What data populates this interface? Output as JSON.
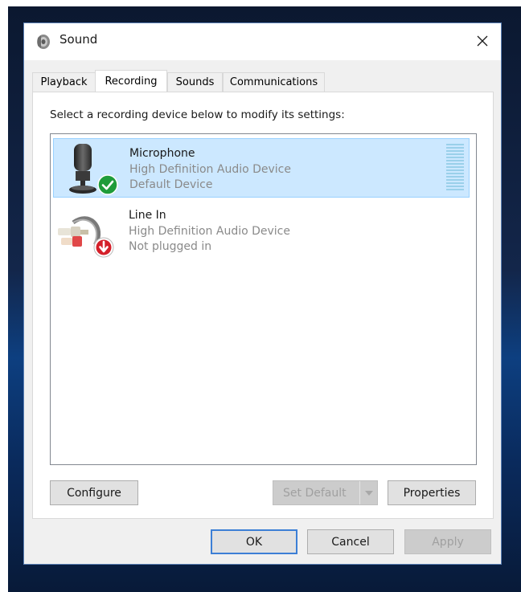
{
  "window": {
    "title": "Sound",
    "icon": "speaker-icon"
  },
  "tabs": [
    {
      "label": "Playback",
      "active": false
    },
    {
      "label": "Recording",
      "active": true
    },
    {
      "label": "Sounds",
      "active": false
    },
    {
      "label": "Communications",
      "active": false
    }
  ],
  "instruction": "Select a recording device below to modify its settings:",
  "devices": [
    {
      "name": "Microphone",
      "description": "High Definition Audio Device",
      "status": "Default Device",
      "icon": "microphone-icon",
      "badge": "default-checkmark-icon",
      "selected": true
    },
    {
      "name": "Line In",
      "description": "High Definition Audio Device",
      "status": "Not plugged in",
      "icon": "line-in-cable-icon",
      "badge": "unplugged-arrow-icon",
      "selected": false
    }
  ],
  "buttons": {
    "configure": "Configure",
    "set_default": "Set Default",
    "properties": "Properties",
    "ok": "OK",
    "cancel": "Cancel",
    "apply": "Apply"
  },
  "colors": {
    "selection_bg": "#cce8ff",
    "selection_border": "#99d1ff",
    "default_badge": "#1f9c3a",
    "unplugged_badge": "#d4202a",
    "ok_focus": "#3c7fd6"
  }
}
